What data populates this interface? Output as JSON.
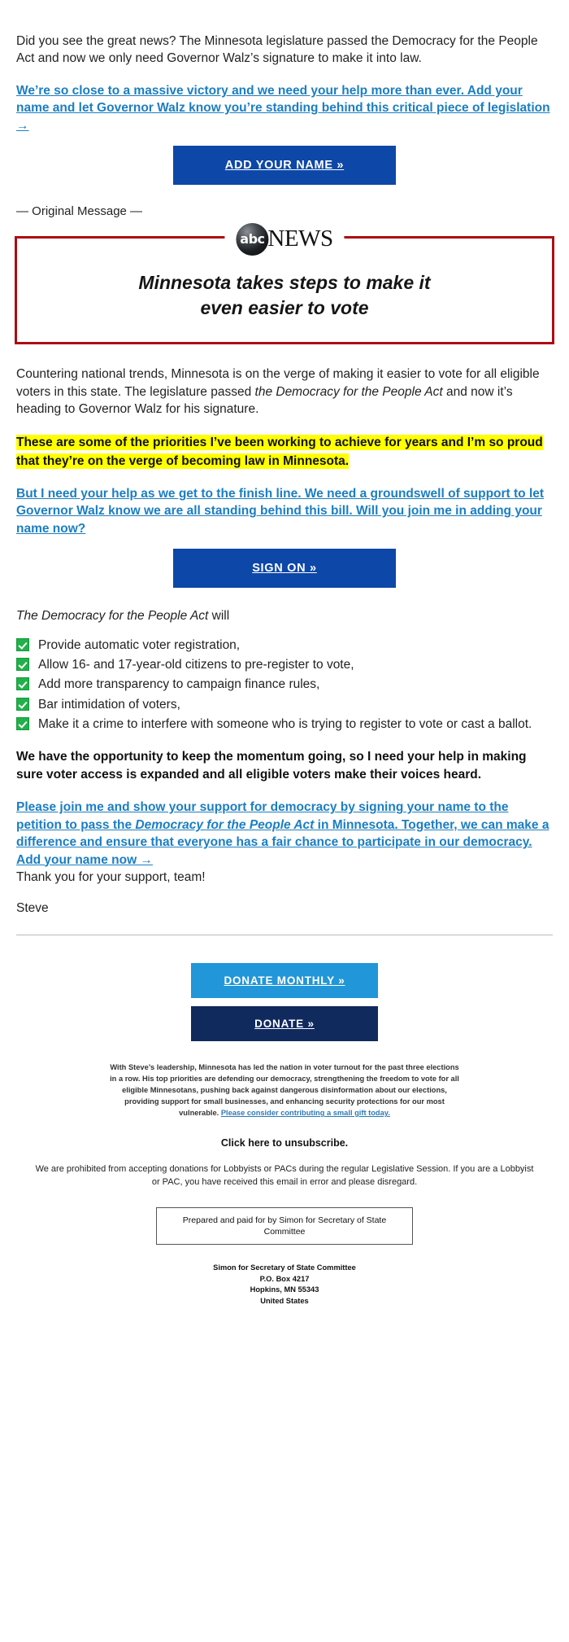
{
  "colors": {
    "primary_button": "#0d47a8",
    "link": "#1b7ec2",
    "highlight": "#ffff00",
    "news_border": "#ac0d13",
    "check_green": "#22b04b",
    "donate_monthly": "#2196d8",
    "donate": "#112a5e"
  },
  "forward": {
    "intro_paragraph": "Did you see the great news? The Minnesota legislature passed the Democracy for the People Act and now we only need Governor Walz’s signature to make it into law.",
    "link_paragraph": "We’re so close to a massive victory and we need your help more than ever. Add your name and let Governor Walz know you’re standing behind this critical piece of legislation →",
    "cta_label": "ADD YOUR NAME »",
    "original_message_label": "— Original Message —"
  },
  "news_card": {
    "logo_mark": "abc",
    "logo_word": "NEWS",
    "headline_line_1": "Minnesota takes steps to make it",
    "headline_line_2": "even easier to vote"
  },
  "body": {
    "paragraph_1_part_1": "Countering national trends, Minnesota is on the verge of making it easier to vote for all eligible voters in this state. The legislature passed ",
    "paragraph_1_italic": "the Democracy for the People Act",
    "paragraph_1_part_2": " and now it’s heading to Governor Walz for his signature.",
    "highlight_paragraph": "These are some of the priorities I’ve been working to achieve for years and I’m so proud that they’re on the verge of becoming law in Minnesota.",
    "link_paragraph_2": "But I need your help as we get to the finish line. We need a groundswell of support to let Governor Walz know we are all standing behind this bill. Will you join me in adding your name now?",
    "sign_on_label": "SIGN ON »",
    "list_intro_italic": "The Democracy for the People Act",
    "list_intro_rest": " will",
    "checklist": [
      "Provide automatic voter registration,",
      "Allow 16- and 17-year-old citizens to pre-register to vote,",
      "Add more transparency to campaign finance rules,",
      "Bar intimidation of voters,",
      "Make it a crime to interfere with someone who is trying to register to vote or cast a ballot."
    ],
    "momentum_paragraph": "We have the opportunity to keep the momentum going, so I need your help in making sure voter access is expanded and all eligible voters make their voices heard.",
    "closing_link_part_1": "Please join me and show your support for democracy by signing your name to the petition to pass the ",
    "closing_link_italic": "Democracy for the People Act",
    "closing_link_part_2": " in Minnesota. Together, we can make a difference and ensure that everyone has a fair chance to participate in our democracy. Add your name now →",
    "thank_you": "Thank you for your support, team!",
    "signature": "Steve"
  },
  "footer": {
    "donate_monthly_label": "DONATE MONTHLY »",
    "donate_label": "DONATE »",
    "fineprint_text": "With Steve’s leadership, Minnesota has led the nation in voter turnout for the past three elections in a row. His top priorities are defending our democracy, strengthening the freedom to vote for all eligible Minnesotans, pushing back against dangerous disinformation about our elections, providing support for small businesses, and enhancing security protections for our most vulnerable. ",
    "fineprint_link": "Please consider contributing a small gift today.",
    "unsubscribe_label": "Click here to unsubscribe.",
    "disclaimer": "We are prohibited from accepting donations for Lobbyists or PACs during the regular Legislative Session. If you are a Lobbyist or PAC, you have received this email in error and please disregard.",
    "paid_for": "Prepared and paid for by Simon for Secretary of State Committee",
    "address_line_1": "Simon for Secretary of State Committee",
    "address_line_2": "P.O. Box 4217",
    "address_line_3": "Hopkins, MN 55343",
    "address_line_4": "United States"
  }
}
